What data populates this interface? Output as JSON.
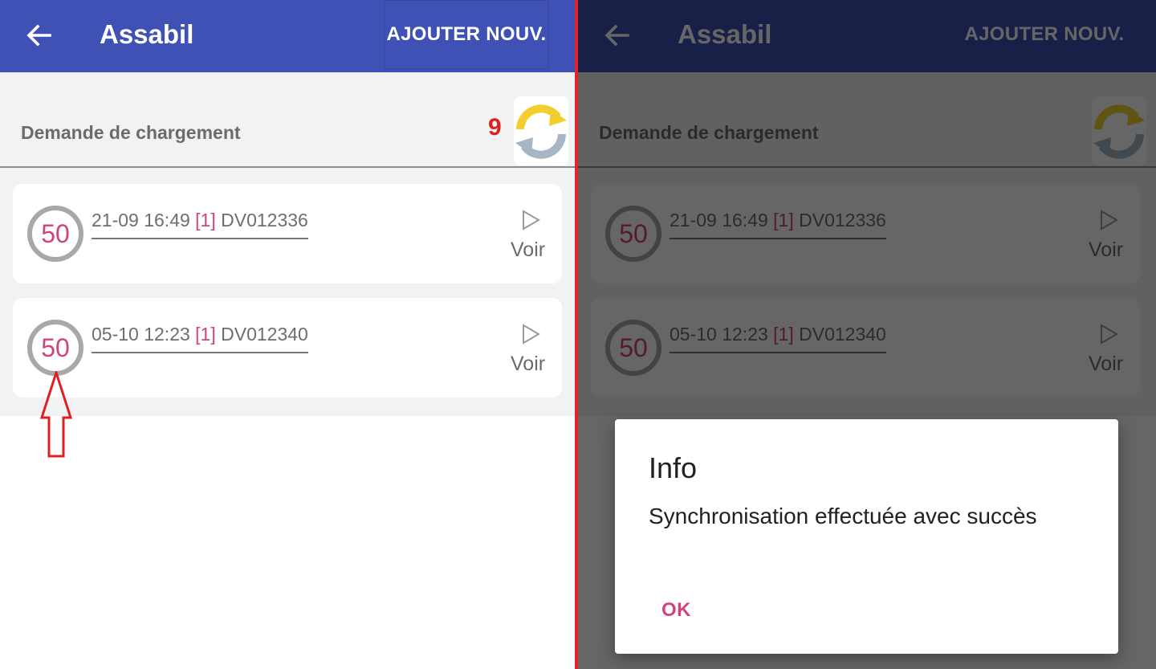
{
  "app": {
    "title": "Assabil",
    "add_button_label": "AJOUTER NOUV."
  },
  "section": {
    "title": "Demande de chargement",
    "sync_count": "9"
  },
  "items": [
    {
      "quantity": "50",
      "date": "21-09 16:49",
      "count": "[1]",
      "ref": "DV012336",
      "action_label": "Voir"
    },
    {
      "quantity": "50",
      "date": "05-10 12:23",
      "count": "[1]",
      "ref": "DV012340",
      "action_label": "Voir"
    }
  ],
  "dialog": {
    "title": "Info",
    "message": "Synchronisation effectuée avec succès",
    "ok_label": "OK"
  },
  "icons": {
    "back": "arrow-left-icon",
    "sync": "sync-icon",
    "play": "play-icon",
    "annotation": "up-arrow-annotation"
  },
  "colors": {
    "app_bar": "#3f51b5",
    "accent": "#d0437e",
    "sync_count": "#e02020",
    "divider": "#e0242c"
  }
}
